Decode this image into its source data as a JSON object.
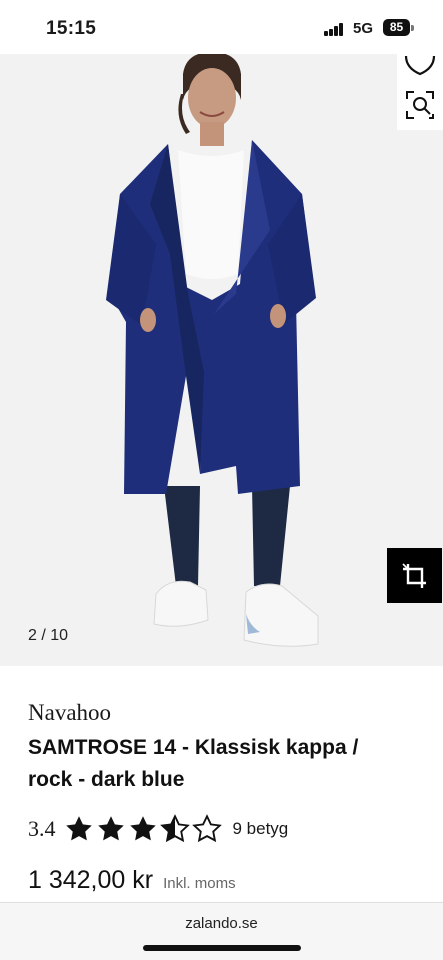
{
  "status_bar": {
    "time": "15:15",
    "network": "5G",
    "battery": "85"
  },
  "gallery": {
    "counter": "2 / 10",
    "icons": [
      "heart-outline-icon",
      "visual-search-icon",
      "crop-icon"
    ],
    "background_color": "#f2f2f2"
  },
  "product": {
    "brand": "Navahoo",
    "title": "SAMTROSE 14 - Klassisk kappa / rock - dark blue",
    "rating_value": "3.4",
    "rating_stars": 3.4,
    "rating_max": 5,
    "rating_count": "9 betyg",
    "price": "1 342,00 kr",
    "tax_note": "Inkl. moms",
    "coat_color": "#1f2e7a"
  },
  "footer": {
    "domain": "zalando.se"
  }
}
